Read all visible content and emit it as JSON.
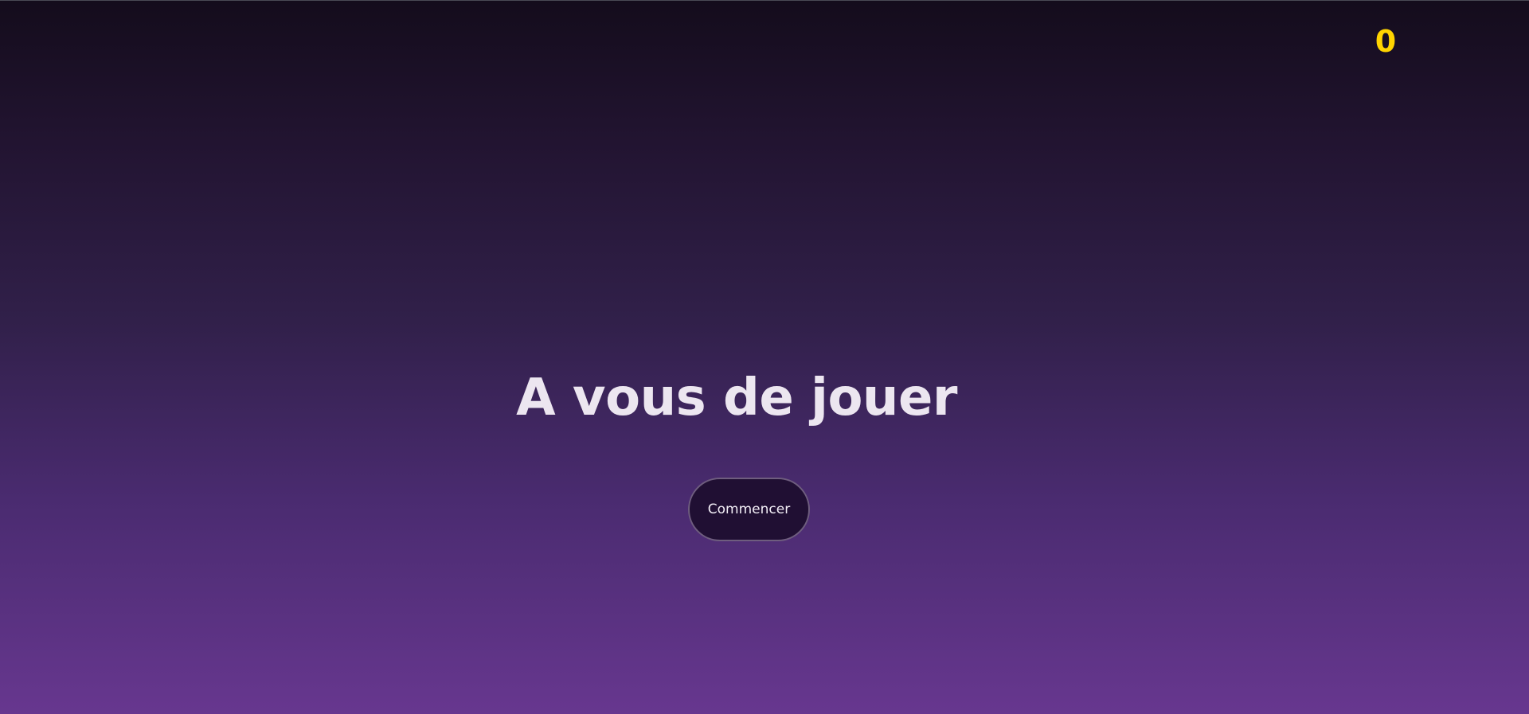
{
  "score": {
    "value": "0"
  },
  "main": {
    "title": "A vous de jouer",
    "start_label": "Commencer"
  },
  "colors": {
    "score": "#ffd400",
    "title": "#ece6f0",
    "button_bg": "#200f33",
    "background_top": "#140c1c",
    "background_bottom": "#67378f"
  }
}
